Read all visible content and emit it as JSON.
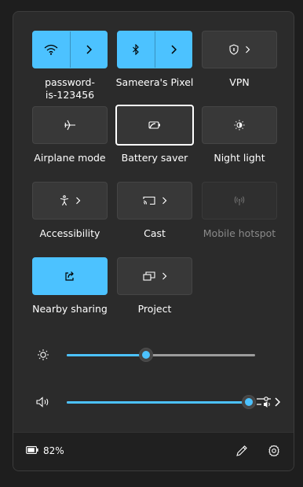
{
  "tiles": {
    "wifi": {
      "label": "password-\nis-123456",
      "label_line1": "password-",
      "label_line2": "is-123456",
      "state": "on"
    },
    "bluetooth": {
      "label": "Sameera's Pixel",
      "state": "on"
    },
    "vpn": {
      "label": "VPN",
      "state": "off"
    },
    "airplane": {
      "label": "Airplane mode",
      "state": "off"
    },
    "battery_saver": {
      "label": "Battery saver",
      "state": "off"
    },
    "night_light": {
      "label": "Night light",
      "state": "off"
    },
    "accessibility": {
      "label": "Accessibility",
      "state": "off"
    },
    "cast": {
      "label": "Cast",
      "state": "off"
    },
    "mobile_hotspot": {
      "label": "Mobile hotspot",
      "state": "disabled"
    },
    "nearby_sharing": {
      "label": "Nearby sharing",
      "state": "on"
    },
    "project": {
      "label": "Project",
      "state": "off"
    }
  },
  "sliders": {
    "brightness": {
      "value": 0.42
    },
    "volume": {
      "value": 1.0
    }
  },
  "footer": {
    "battery_text": "82%"
  },
  "colors": {
    "accent": "#4cc2ff",
    "panel": "#2b2b2b",
    "tile": "#383838"
  },
  "icons": [
    "wifi-icon",
    "bluetooth-icon",
    "shield-icon",
    "airplane-icon",
    "battery-saver-icon",
    "night-light-icon",
    "accessibility-icon",
    "cast-icon",
    "hotspot-icon",
    "share-icon",
    "project-icon",
    "brightness-icon",
    "volume-icon",
    "audio-output-icon",
    "battery-icon",
    "pencil-icon",
    "gear-icon",
    "chevron-right-icon"
  ]
}
